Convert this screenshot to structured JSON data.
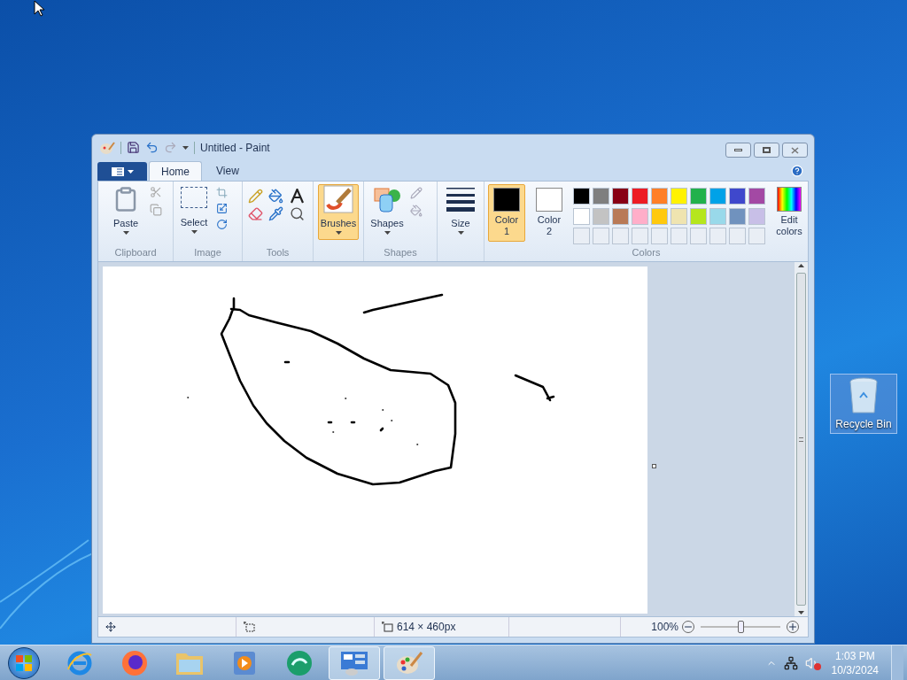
{
  "window": {
    "title": "Untitled - Paint"
  },
  "tabs": [
    {
      "label": "Home",
      "selected": true
    },
    {
      "label": "View",
      "selected": false
    }
  ],
  "ribbon": {
    "clipboard": {
      "paste": "Paste",
      "label": "Clipboard"
    },
    "image": {
      "select": "Select",
      "label": "Image"
    },
    "tools": {
      "label": "Tools"
    },
    "brushes": {
      "label": "Brushes",
      "selected": true
    },
    "shapes": {
      "button": "Shapes",
      "label": "Shapes"
    },
    "size": {
      "label": "Size"
    },
    "colors": {
      "label": "Colors",
      "edit": "Edit colors",
      "color1": {
        "label": "Color 1",
        "color": "#000000",
        "selected": true
      },
      "color2": {
        "label": "Color 2",
        "color": "#ffffff",
        "selected": false
      },
      "palette": [
        {
          "color": "#000000"
        },
        {
          "color": "#7f7f7f"
        },
        {
          "color": "#880015"
        },
        {
          "color": "#ed1c24"
        },
        {
          "color": "#ff7f27"
        },
        {
          "color": "#fff200"
        },
        {
          "color": "#22b14c"
        },
        {
          "color": "#00a2e8"
        },
        {
          "color": "#3f48cc"
        },
        {
          "color": "#a349a4"
        },
        {
          "color": "#ffffff"
        },
        {
          "color": "#c3c3c3"
        },
        {
          "color": "#b97a57"
        },
        {
          "color": "#ffaec9"
        },
        {
          "color": "#ffc90e"
        },
        {
          "color": "#efe4b0"
        },
        {
          "color": "#b5e61d"
        },
        {
          "color": "#99d9ea"
        },
        {
          "color": "#7092be"
        },
        {
          "color": "#c8bfe7"
        }
      ]
    }
  },
  "status_bar": {
    "dimensions": "614 × 460px",
    "zoom": "100%",
    "zoom_slider": {
      "level": 0.5
    }
  },
  "desktop_icons": [
    {
      "label": "Recycle Bin",
      "selected": true
    }
  ],
  "taskbar": {
    "items": [
      {
        "kind": "browser-e",
        "running": false
      },
      {
        "kind": "browser-fox",
        "running": false
      },
      {
        "kind": "folder",
        "running": false
      },
      {
        "kind": "media",
        "running": false
      },
      {
        "kind": "globe",
        "running": false
      },
      {
        "kind": "monitor",
        "running": true
      },
      {
        "kind": "palette",
        "running": true
      }
    ],
    "time": "1:03 PM",
    "date": "10/3/2024"
  }
}
